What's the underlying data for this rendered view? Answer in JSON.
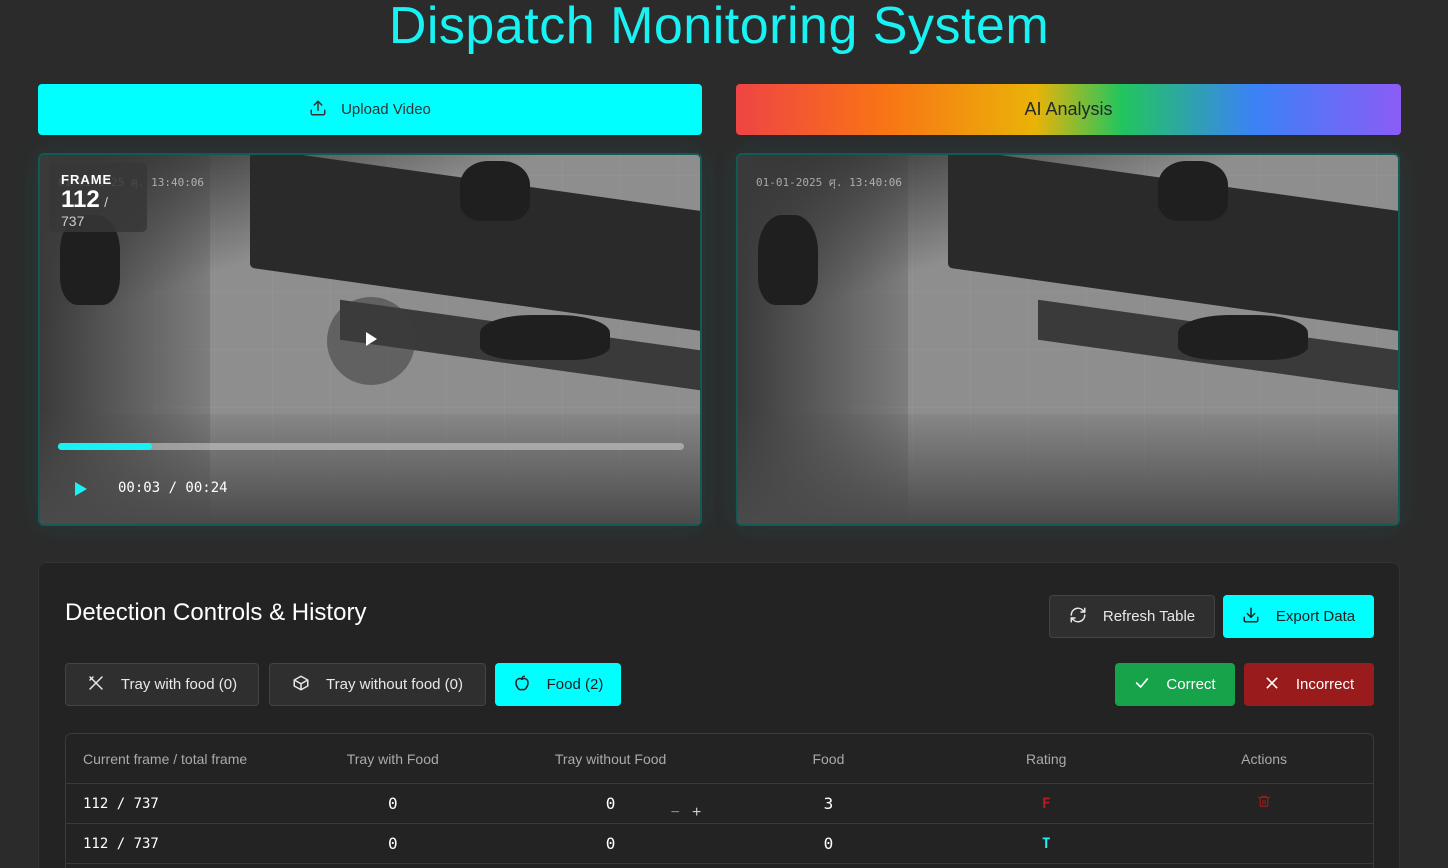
{
  "header": {
    "title": "Dispatch Monitoring System"
  },
  "toolbar": {
    "upload_label": "Upload Video",
    "ai_label": "AI Analysis",
    "upload_icon": "upload-icon"
  },
  "player_left": {
    "frame_label": "FRAME",
    "frame_current": "112",
    "frame_total": "/ 737",
    "time": "00:03 / 00:24",
    "progress_fraction": 0.15,
    "timestamp": "01-01-2025 ศุ. 13:40:06"
  },
  "player_right": {
    "timestamp": "01-01-2025 ศุ. 13:40:06"
  },
  "panel": {
    "title": "Detection Controls & History",
    "refresh_label": "Refresh Table",
    "export_label": "Export Data",
    "filters": [
      {
        "label": "Tray with food (0)",
        "icon": "utensils-crossed-icon",
        "active": false
      },
      {
        "label": "Tray without food (0)",
        "icon": "box-icon",
        "active": false
      },
      {
        "label": "Food (2)",
        "icon": "apple-icon",
        "active": true
      }
    ],
    "correct_label": "Correct",
    "incorrect_label": "Incorrect"
  },
  "table": {
    "headers": [
      "Current frame / total frame",
      "Tray with Food",
      "Tray without Food",
      "Food",
      "Rating",
      "Actions"
    ],
    "rows": [
      {
        "frame": "112 / 737",
        "tray_with_food": "0",
        "tray_without_food": "0",
        "food": "3",
        "rating": "F"
      },
      {
        "frame": "112 / 737",
        "tray_with_food": "0",
        "tray_without_food": "0",
        "food": "0",
        "rating": "T"
      }
    ]
  },
  "colors": {
    "accent": "#00ffff",
    "background": "#2b2b2b",
    "correct": "#16a34a",
    "incorrect": "#991b1b"
  }
}
